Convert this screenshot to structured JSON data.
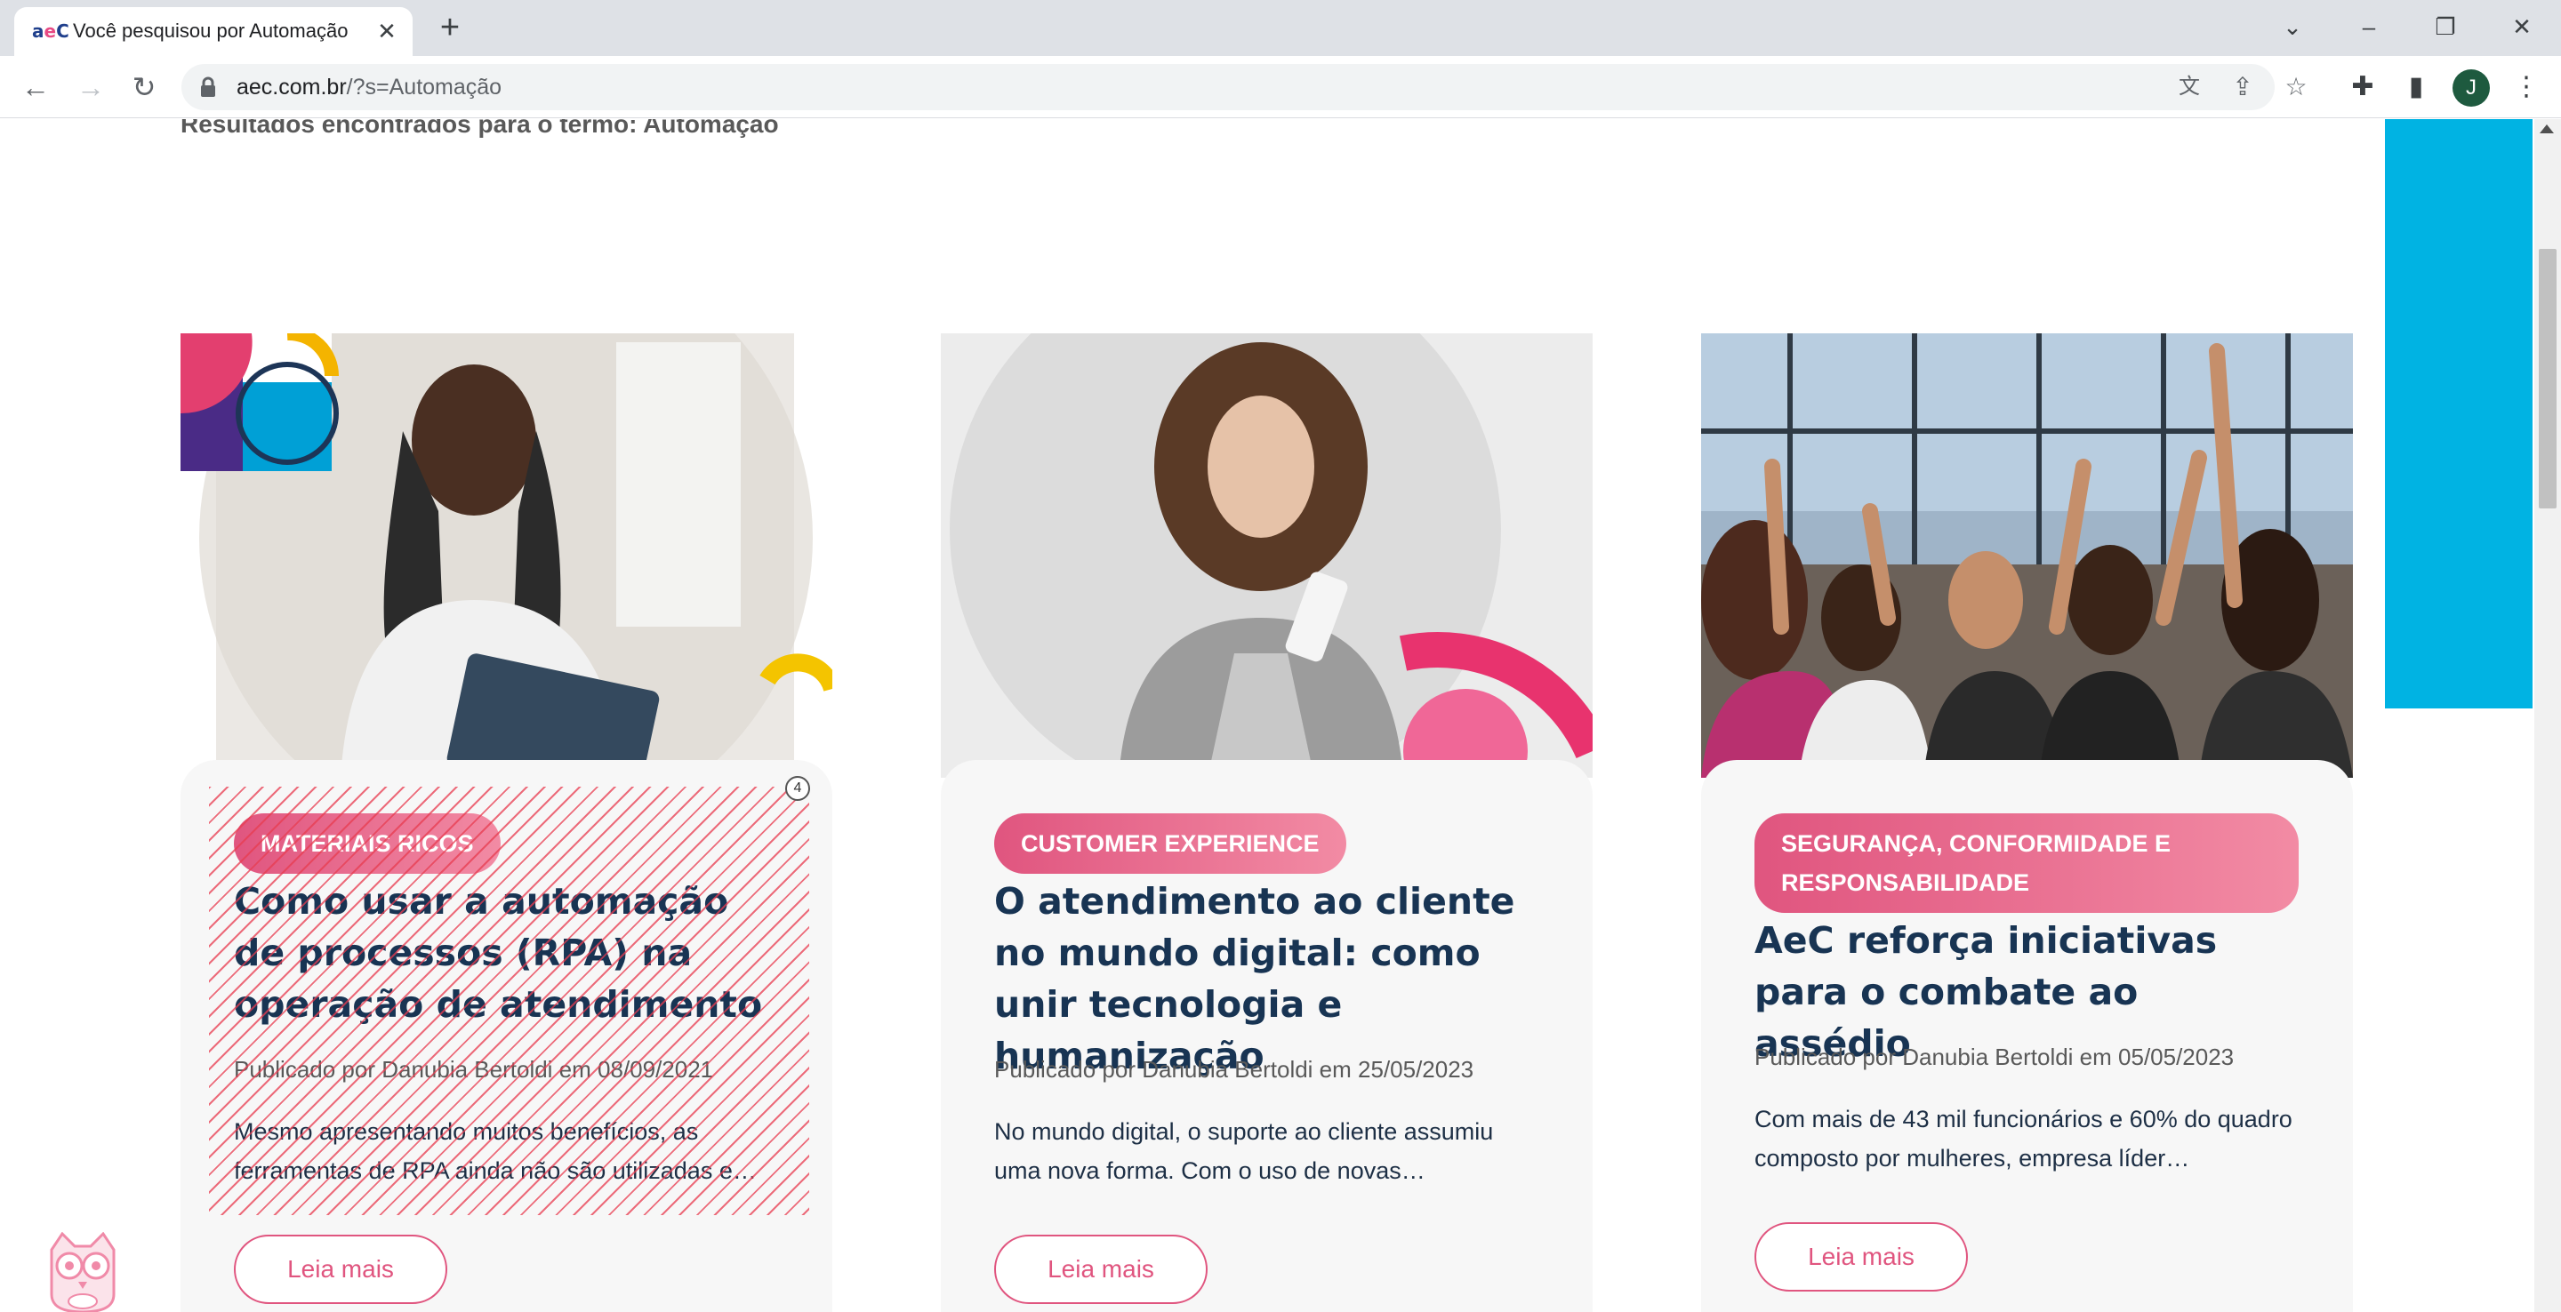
{
  "browser": {
    "tab": {
      "favicon_text": "aeC",
      "title": "Você pesquisou por Automação",
      "close_icon": "close-icon"
    },
    "new_tab_icon": "plus-icon",
    "window_controls": [
      "chevron-down-icon",
      "minimize-icon",
      "restore-icon",
      "close-icon"
    ],
    "url_domain": "aec.com.br",
    "url_path": "/?s=Automação",
    "avatar_letter": "J"
  },
  "page": {
    "result_text": "Resultados encontrados para o termo: Automação",
    "accent_color": "#00b3e3",
    "tag_color": "#e0557f",
    "title_color": "#183453"
  },
  "cards": [
    {
      "tag": "MATERIAIS RICOS",
      "title": "Como usar a automação de processos (RPA) na operação de atendimento",
      "meta": "Publicado por Danubia Bertoldi em 08/09/2021",
      "excerpt": "Mesmo apresentando muitos benefícios, as ferramentas de RPA ainda não são utilizadas e…",
      "button": "Leia mais",
      "overlay_badge": "4"
    },
    {
      "tag": "CUSTOMER EXPERIENCE",
      "title": "O atendimento ao cliente no mundo digital: como unir tecnologia e humanização",
      "meta": "Publicado por Danubia Bertoldi em 25/05/2023",
      "excerpt": "No mundo digital, o suporte ao cliente assumiu uma nova forma. Com o uso de novas…",
      "button": "Leia mais"
    },
    {
      "tag": "SEGURANÇA, CONFORMIDADE E RESPONSABILIDADE",
      "title": "AeC reforça iniciativas para o combate ao assédio",
      "meta": "Publicado por Danubia Bertoldi em 05/05/2023",
      "excerpt": "Com mais de 43 mil funcionários e 60% do quadro composto por mulheres, empresa líder…",
      "button": "Leia mais"
    }
  ]
}
